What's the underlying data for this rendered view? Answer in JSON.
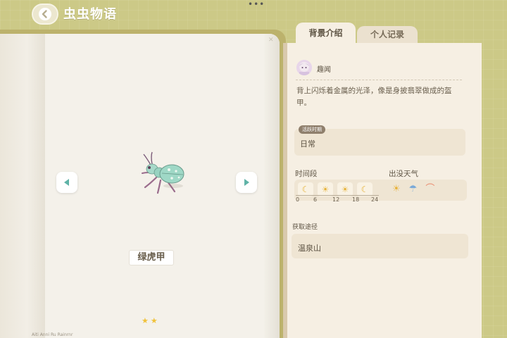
{
  "header": {
    "title": "虫虫物语",
    "more_icon": "ellipsis-icon",
    "back_icon": "chevron-left-icon"
  },
  "book": {
    "insect_name": "绿虎甲",
    "rarity_stars": 2,
    "star_glyph": "★",
    "footer_note": "Aiti  Anni  Ru Rainrnr",
    "prev_icon": "arrow-left-icon",
    "next_icon": "arrow-right-icon"
  },
  "tabs": [
    {
      "label": "背景介绍",
      "active": true
    },
    {
      "label": "个人记录",
      "active": false
    }
  ],
  "trivia": {
    "label": "趣闻",
    "description": "背上闪烁着金属的光泽，像是身披翡翠做成的盔甲。"
  },
  "active_period": {
    "badge": "活跃时期",
    "value": "日常"
  },
  "time_period": {
    "label": "时间段",
    "slots": [
      "moon-icon",
      "sun-rising-icon",
      "sun-icon",
      "moon-icon"
    ],
    "ticks": [
      "0",
      "6",
      "12",
      "18",
      "24"
    ]
  },
  "weather": {
    "label": "出没天气",
    "icons": [
      "sun-icon",
      "rain-cloud-icon",
      "rainbow-icon"
    ]
  },
  "source": {
    "label": "获取途径",
    "value": "温泉山"
  },
  "colors": {
    "background": "#ccc987",
    "accent_teal": "#5fb3a7",
    "star": "#f0c23a"
  }
}
